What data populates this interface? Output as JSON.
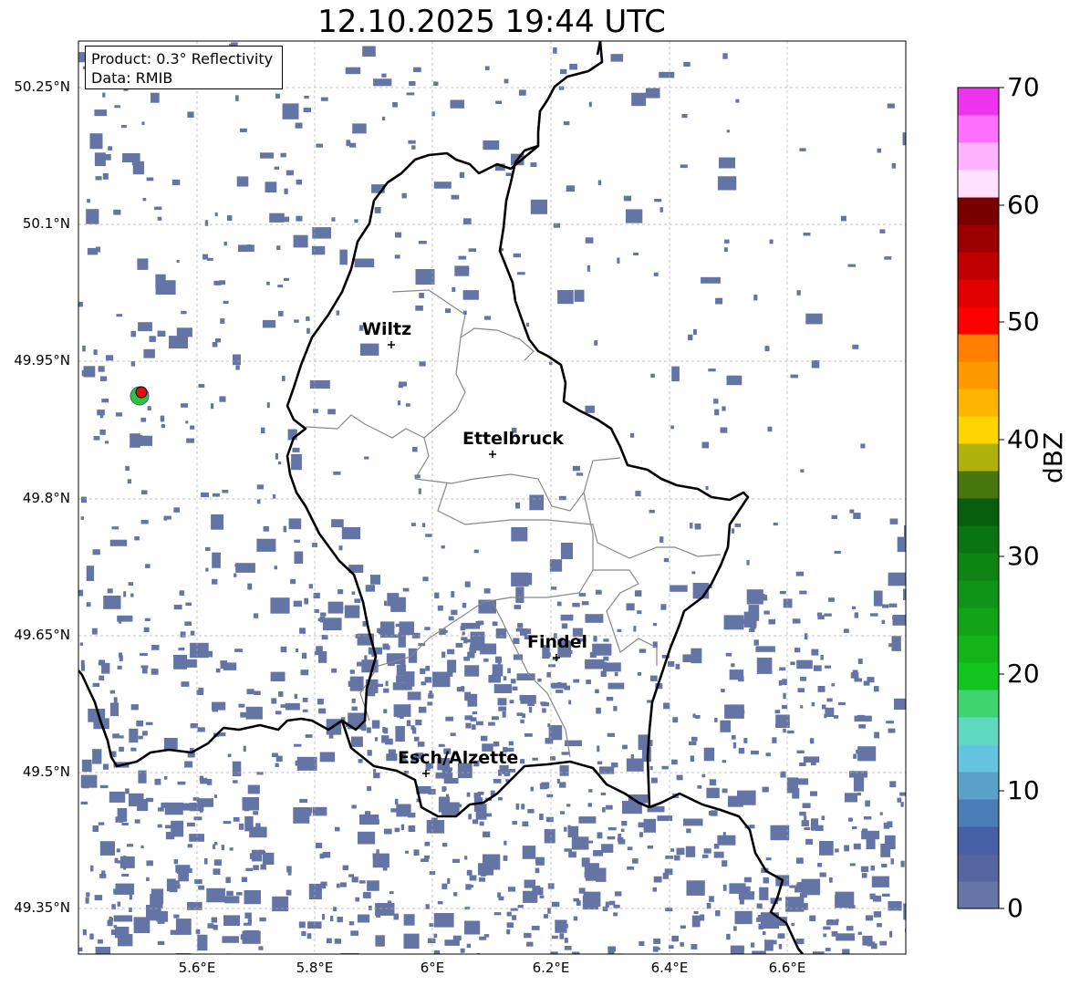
{
  "title": "12.10.2025 19:44 UTC",
  "info_box": {
    "product": "Product: 0.3° Reflectivity",
    "data": "Data: RMIB"
  },
  "map": {
    "lon_ticks": [
      "5.6°E",
      "5.8°E",
      "6°E",
      "6.2°E",
      "6.4°E",
      "6.6°E"
    ],
    "lat_ticks": [
      "50.25°N",
      "50.1°N",
      "49.95°N",
      "49.8°N",
      "49.65°N",
      "49.5°N",
      "49.35°N"
    ],
    "grid": true,
    "cities": [
      {
        "name": "Wiltz"
      },
      {
        "name": "Ettelbruck"
      },
      {
        "name": "Findel"
      },
      {
        "name": "Esch/Alzette"
      }
    ],
    "radar_site_marker": "red-dot",
    "echo_color": "#6474a4"
  },
  "colorbar": {
    "label": "dBZ",
    "tick_labels": [
      "0",
      "10",
      "20",
      "30",
      "40",
      "50",
      "60",
      "70"
    ],
    "min": 0,
    "max": 70,
    "colors": [
      "#6675a5",
      "#5465a0",
      "#4560a5",
      "#4a7db5",
      "#5aa0c8",
      "#64c3dd",
      "#5fd8c0",
      "#3ed46e",
      "#12c41e",
      "#12b41a",
      "#12a416",
      "#109418",
      "#0e8415",
      "#0a7412",
      "#085e0c",
      "#47760c",
      "#b0b10c",
      "#fed500",
      "#feb500",
      "#fe9900",
      "#ff7f00",
      "#ff0000",
      "#e00000",
      "#c00000",
      "#9a0000",
      "#780000",
      "#ffe0ff",
      "#ffb3ff",
      "#ff70ff",
      "#ee33ee"
    ]
  }
}
